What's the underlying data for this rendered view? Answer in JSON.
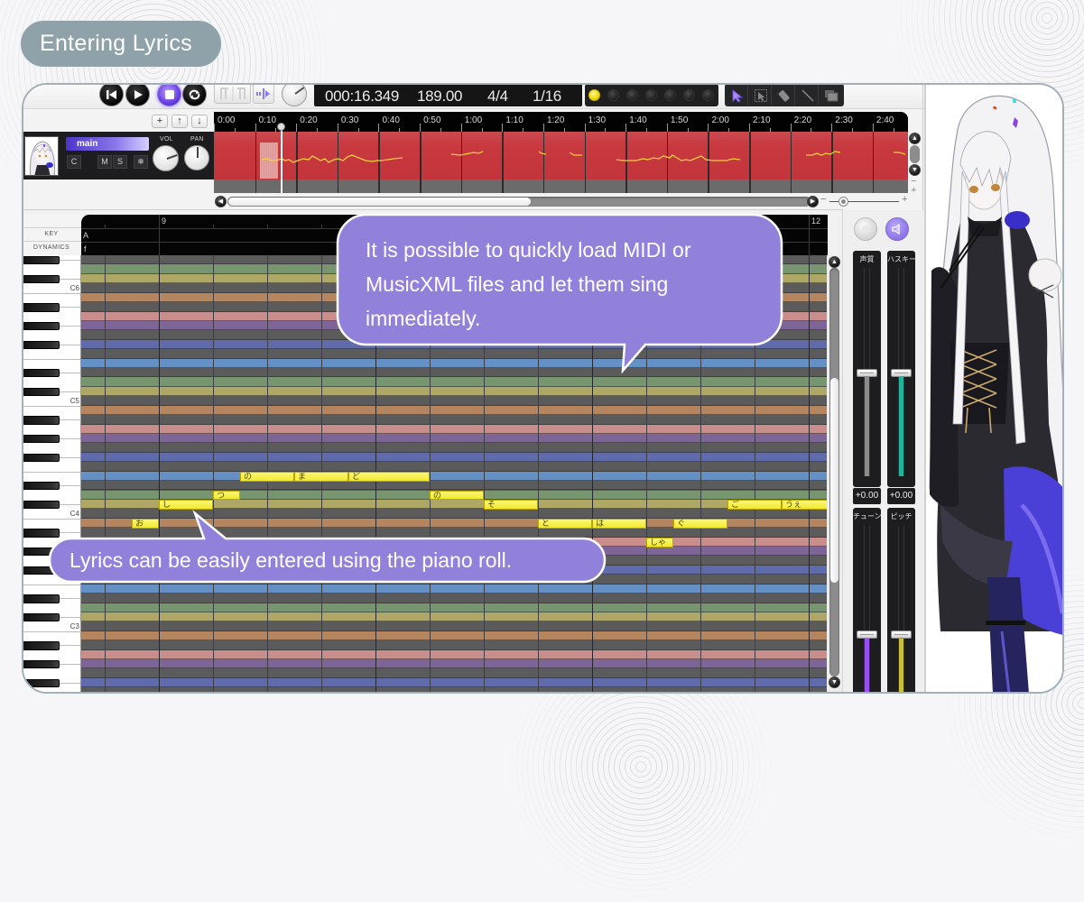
{
  "page": {
    "title": "Entering Lyrics"
  },
  "toolbar": {
    "transport": [
      {
        "name": "rewind-button",
        "icon": "skip-to-start-icon"
      },
      {
        "name": "play-button",
        "icon": "play-icon"
      },
      {
        "name": "stop-button",
        "icon": "stop-icon",
        "active": true
      },
      {
        "name": "loop-button",
        "icon": "loop-icon"
      }
    ],
    "display": {
      "time": "000:16.349",
      "tempo": "189.00",
      "time_signature": "4/4",
      "quantize": "1/16"
    },
    "led_toggles": {
      "count": 7,
      "active_index": 0
    },
    "tools": [
      {
        "name": "pointer-tool",
        "icon": "pointer-icon",
        "active": true
      },
      {
        "name": "select-tool",
        "icon": "select-arrow-icon"
      },
      {
        "name": "eraser-tool",
        "icon": "eraser-icon"
      },
      {
        "name": "line-tool",
        "icon": "line-icon"
      },
      {
        "name": "layers-tool",
        "icon": "layers-icon"
      }
    ]
  },
  "track_controls": {
    "add": "+",
    "move_up": "↑",
    "move_down": "↓"
  },
  "timeline": {
    "labels": [
      "0:00",
      "0:10",
      "0:20",
      "0:30",
      "0:40",
      "0:50",
      "1:00",
      "1:10",
      "1:20",
      "1:30",
      "1:40",
      "1:50",
      "2:00",
      "2:10",
      "2:20",
      "2:30",
      "2:40"
    ],
    "h_scroll": {
      "start": 0.0,
      "size": 0.52
    },
    "zoom_level": 0.2,
    "zoom_minus": "−",
    "zoom_plus": "+"
  },
  "track": {
    "name": "main",
    "buttons": {
      "c": "C",
      "m": "M",
      "s": "S",
      "freeze": "❄"
    },
    "vol_label": "VOL",
    "pan_label": "PAN",
    "vol": 0.76,
    "pan": 0.5,
    "side_minus": "−",
    "side_plus": "+"
  },
  "piano_roll": {
    "key_label": "KEY",
    "dynamics_label": "DYNAMICS",
    "key_value": "A",
    "dynamics_value": "f",
    "measure_labels": [
      {
        "label": "9",
        "beat": 0
      },
      {
        "label": "12",
        "beat": 12
      }
    ],
    "octave_labels": [
      "C6",
      "C5",
      "C4",
      "C3"
    ],
    "row_colors": {
      "A": "#c98d8b",
      "B": "#b4855f",
      "C#": "#aea766",
      "D": "#77966f",
      "E": "#6590c5",
      "F#": "#5f6bab",
      "G#": "#7d6697",
      "other": "#5b5b5b"
    },
    "note_color": "#f3ec35",
    "notes": [
      {
        "lyric": "お",
        "pitch": "B3",
        "start": -0.5,
        "length": 0.5
      },
      {
        "lyric": "し",
        "pitch": "C#4",
        "start": 0,
        "length": 1
      },
      {
        "lyric": "つ",
        "pitch": "D4",
        "start": 1,
        "length": 0.5
      },
      {
        "lyric": "の",
        "pitch": "E4",
        "start": 1.5,
        "length": 1
      },
      {
        "lyric": "ま",
        "pitch": "E4",
        "start": 2.5,
        "length": 1
      },
      {
        "lyric": "ど",
        "pitch": "E4",
        "start": 3.5,
        "length": 1.5
      },
      {
        "lyric": "の",
        "pitch": "D4",
        "start": 5,
        "length": 1
      },
      {
        "lyric": "そ",
        "pitch": "C#4",
        "start": 6,
        "length": 1
      },
      {
        "lyric": "と",
        "pitch": "B3",
        "start": 7,
        "length": 1
      },
      {
        "lyric": "は",
        "pitch": "B3",
        "start": 8,
        "length": 1
      },
      {
        "lyric": "しゃ",
        "pitch": "A3",
        "start": 9,
        "length": 0.5
      },
      {
        "lyric": "ぐ",
        "pitch": "B3",
        "start": 9.5,
        "length": 1
      },
      {
        "lyric": "ご",
        "pitch": "C#4",
        "start": 10.5,
        "length": 1
      },
      {
        "lyric": "うぇ",
        "pitch": "C#4",
        "start": 11.5,
        "length": 1
      }
    ],
    "v_scroll": {
      "start": 0.27,
      "size": 0.5
    }
  },
  "mixer": {
    "buttons": [
      {
        "name": "solo-toggle",
        "icon": "circle-icon"
      },
      {
        "name": "speaker-button",
        "icon": "speaker-icon"
      }
    ],
    "sliders": [
      {
        "label": "声質",
        "value": "+0.00",
        "level": 0.5,
        "color": "#8b8b8b"
      },
      {
        "label": "ハスキー",
        "value": "+0.00",
        "level": 0.5,
        "color": "#20b39c"
      },
      {
        "label": "チューン",
        "level": 0.5,
        "color": "#9a4ff0"
      },
      {
        "label": "ピッチ",
        "level": 0.5,
        "color": "#c8be3c"
      }
    ]
  },
  "callouts": [
    {
      "lines": [
        "It is possible to quickly load MIDI or",
        "MusicXML files and let them sing",
        "immediately."
      ]
    },
    {
      "lines": [
        "Lyrics can be easily entered using the piano roll."
      ]
    }
  ],
  "colors": {
    "accent": "#9281da",
    "title_pill": "#8fa2aa"
  }
}
